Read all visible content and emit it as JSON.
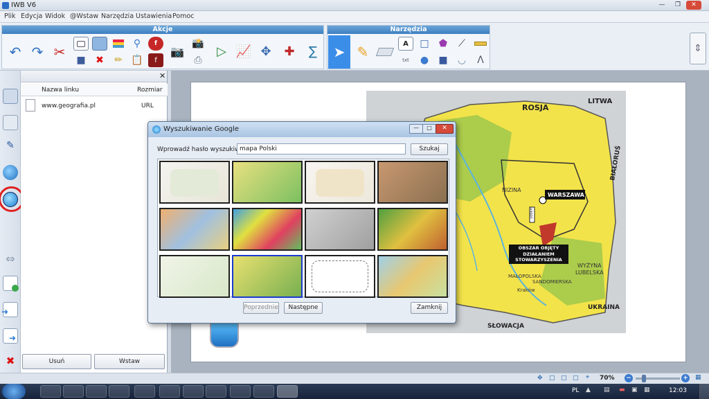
{
  "window": {
    "title": "IWB V6"
  },
  "menu": [
    "Plik",
    "Edycja",
    "Widok",
    "@Wstaw",
    "Narzędzia",
    "Ustawienia",
    "Pomoc"
  ],
  "ribbon": {
    "group_actions": "Akcje",
    "group_tools": "Narzędzia",
    "tool_text_label": "txt"
  },
  "panel": {
    "col_name": "Nazwa linku",
    "col_size": "Rozmiar",
    "rows": [
      {
        "name": "www.geografia.pl",
        "size": "URL"
      }
    ],
    "btn_remove": "Usuń",
    "btn_insert": "Wstaw"
  },
  "map": {
    "label_russia": "ROSJA",
    "label_lithuania": "LITWA",
    "label_belarus": "BIAŁORUŚ",
    "label_ukraine": "UKRAINA",
    "label_slovakia": "SŁOWACJA",
    "label_warsaw": "WARSZAWA",
    "label_area": "OBSZAR OBJĘTY DZIAŁANIEM STOWARZYSZENIA",
    "label_lowland": "NIZINA",
    "label_upland": "WYŻYNA",
    "label_lublin": "LUBELSKA",
    "label_malopolska": "MAŁOPOLSKA",
    "label_sandomierz": "SANDOMIERSKA",
    "label_krakow": "Kraków",
    "label_scale": "100km"
  },
  "dialog": {
    "title": "Wyszukiwanie Google",
    "prompt": "Wprowadź hasło wyszukiwania",
    "query": "mapa Polski",
    "btn_search": "Szukaj",
    "btn_prev": "Poprzednie",
    "btn_next": "Następne",
    "btn_close": "Zamknij"
  },
  "status": {
    "zoom": "70%"
  },
  "taskbar": {
    "lang": "PL",
    "time": "12:03"
  },
  "colors": {
    "accent": "#3d7fc1",
    "selected_tool": "#3b8ee8",
    "map_land": "#f3e34a",
    "map_forest": "#7dbd4c",
    "map_water": "#5ab4e0",
    "highlight_ring": "#e02020"
  }
}
